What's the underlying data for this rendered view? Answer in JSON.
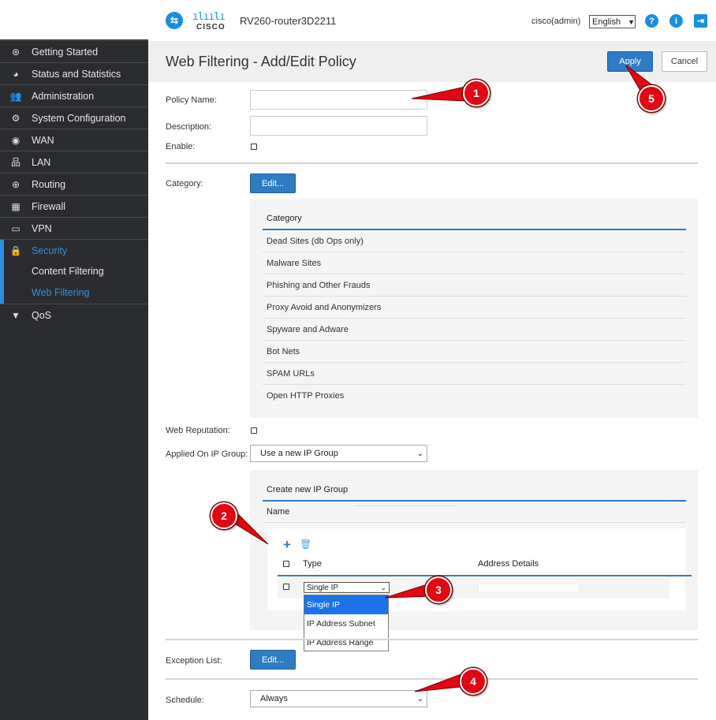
{
  "header": {
    "device_name": "RV260-router3D2211",
    "logo_bars": "ılıılı",
    "logo_word": "CISCO",
    "user": "cisco(admin)",
    "language": "English",
    "help_icon": "?",
    "info_icon": "i",
    "logout_icon": "⇥"
  },
  "sidebar": {
    "items": [
      {
        "label": "Getting Started",
        "icon": "⊛"
      },
      {
        "label": "Status and Statistics",
        "icon": "◕"
      },
      {
        "label": "Administration",
        "icon": "👥"
      },
      {
        "label": "System Configuration",
        "icon": "⚙"
      },
      {
        "label": "WAN",
        "icon": "◉"
      },
      {
        "label": "LAN",
        "icon": "品"
      },
      {
        "label": "Routing",
        "icon": "⊕"
      },
      {
        "label": "Firewall",
        "icon": "▦"
      },
      {
        "label": "VPN",
        "icon": "▭"
      },
      {
        "label": "Security",
        "icon": "🔒"
      },
      {
        "label": "QoS",
        "icon": "▼"
      }
    ],
    "sub_items": [
      {
        "label": "Content Filtering"
      },
      {
        "label": "Web Filtering"
      }
    ]
  },
  "page": {
    "title": "Web Filtering - Add/Edit Policy",
    "apply_label": "Apply",
    "cancel_label": "Cancel"
  },
  "form": {
    "policy_name_label": "Policy Name:",
    "policy_name_value": "",
    "description_label": "Description:",
    "description_value": "",
    "enable_label": "Enable:",
    "category_label": "Category:",
    "edit_label": "Edit...",
    "web_reputation_label": "Web Reputation:",
    "applied_label": "Applied On IP Group:",
    "applied_value": "Use a new IP Group",
    "exception_label": "Exception List:",
    "exception_edit_label": "Edit...",
    "schedule_label": "Schedule:",
    "schedule_value": "Always"
  },
  "category_table": {
    "header": "Category",
    "rows": [
      "Dead Sites (db Ops only)",
      "Malware Sites",
      "Phishing and Other Frauds",
      "Proxy Avoid and Anonymizers",
      "Spyware and Adware",
      "Bot Nets",
      "SPAM URLs",
      "Open HTTP Proxies"
    ]
  },
  "ip_group": {
    "header": "Create new IP Group",
    "name_label": "Name",
    "add_icon": "+",
    "delete_icon": "🗑",
    "col_type": "Type",
    "col_address": "Address Details",
    "type_value": "Single IP",
    "options": [
      "Single IP",
      "IP Address Subnet",
      "IP Address Range"
    ]
  },
  "annotations": [
    "1",
    "2",
    "3",
    "4",
    "5"
  ],
  "colors": {
    "accent": "#2d7cc4",
    "sidebar_bg": "#2b2c30",
    "annotation_red": "#e30613",
    "active_nav": "#2f8fdc"
  }
}
